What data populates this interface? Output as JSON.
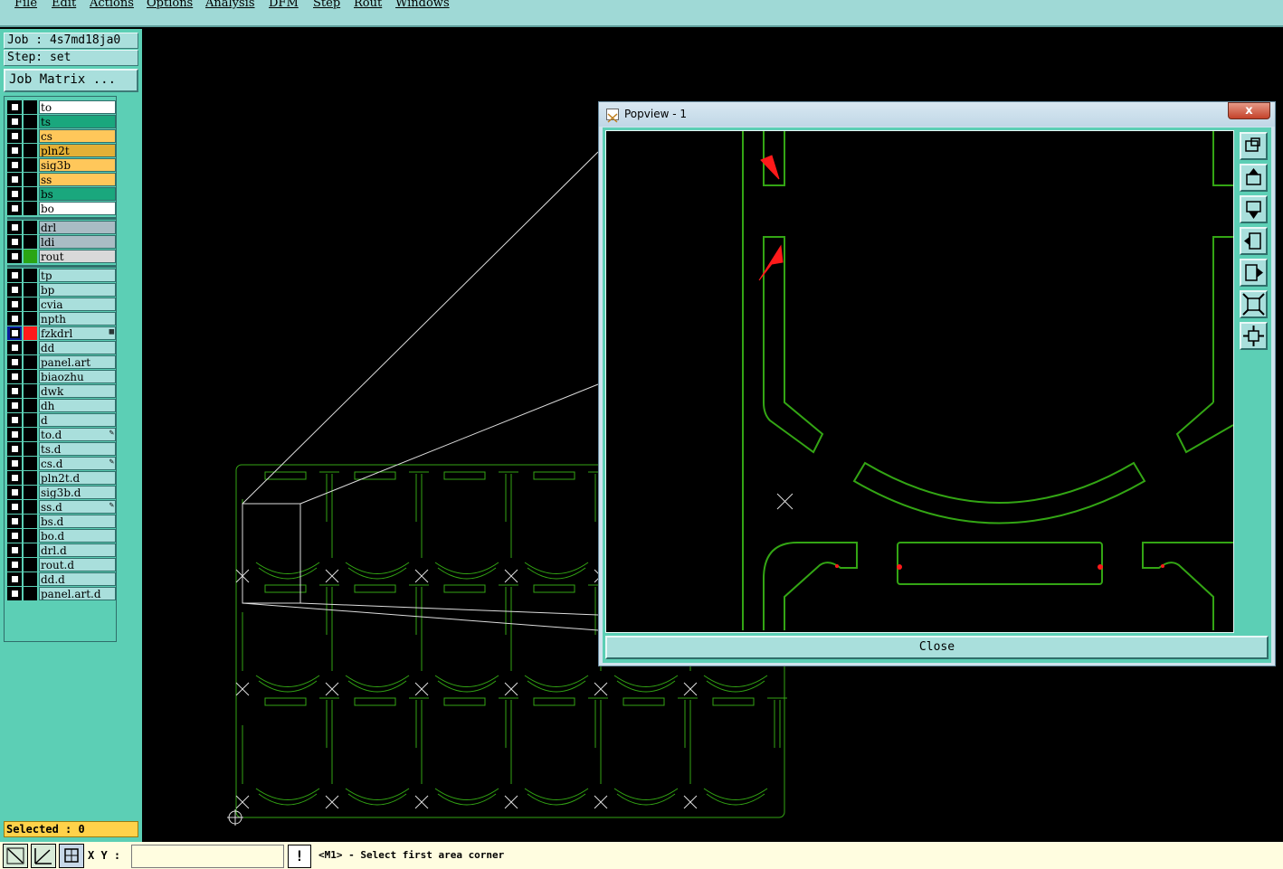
{
  "menu": [
    "File",
    "Edit",
    "Actions",
    "Options",
    "Analysis",
    "DFM",
    "Step",
    "Rout",
    "Windows"
  ],
  "job": {
    "label": "Job : 4s7md18ja0",
    "step": "Step: set",
    "matrix_button": "Job Matrix ..."
  },
  "layers": [
    {
      "name": "to",
      "color": "#ffffff"
    },
    {
      "name": "ts",
      "color": "#1aa77d"
    },
    {
      "name": "cs",
      "color": "#ffc75a"
    },
    {
      "name": "pln2t",
      "color": "#e3b036"
    },
    {
      "name": "sig3b",
      "color": "#ffc75a"
    },
    {
      "name": "ss",
      "color": "#ffc75a"
    },
    {
      "name": "bs",
      "color": "#1aa77d"
    },
    {
      "name": "bo",
      "color": "#ffffff"
    },
    {
      "name": "drl",
      "color": "#a9bcc4"
    },
    {
      "name": "ldi",
      "color": "#a9bcc4"
    },
    {
      "name": "rout",
      "color": "#d9d9d9"
    },
    {
      "name": "tp",
      "color": "#a9dfdc"
    },
    {
      "name": "bp",
      "color": "#a9dfdc"
    },
    {
      "name": "cvia",
      "color": "#a9dfdc"
    },
    {
      "name": "npth",
      "color": "#a9dfdc"
    },
    {
      "name": "fzkdrl",
      "color": "#a9dfdc"
    },
    {
      "name": "dd",
      "color": "#a9dfdc"
    },
    {
      "name": "panel.art",
      "color": "#a9dfdc"
    },
    {
      "name": "biaozhu",
      "color": "#a9dfdc"
    },
    {
      "name": "dwk",
      "color": "#a9dfdc"
    },
    {
      "name": "dh",
      "color": "#a9dfdc"
    },
    {
      "name": "d",
      "color": "#a9dfdc"
    },
    {
      "name": "to.d",
      "color": "#a9dfdc"
    },
    {
      "name": "ts.d",
      "color": "#a9dfdc"
    },
    {
      "name": "cs.d",
      "color": "#a9dfdc"
    },
    {
      "name": "pln2t.d",
      "color": "#a9dfdc"
    },
    {
      "name": "sig3b.d",
      "color": "#a9dfdc"
    },
    {
      "name": "ss.d",
      "color": "#a9dfdc"
    },
    {
      "name": "bs.d",
      "color": "#a9dfdc"
    },
    {
      "name": "bo.d",
      "color": "#a9dfdc"
    },
    {
      "name": "drl.d",
      "color": "#a9dfdc"
    },
    {
      "name": "rout.d",
      "color": "#a9dfdc"
    },
    {
      "name": "dd.d",
      "color": "#a9dfdc"
    },
    {
      "name": "panel.art.d",
      "color": "#a9dfdc"
    }
  ],
  "selected": "Selected : 0",
  "status": {
    "xy_label": "X Y :",
    "xy_value": "",
    "message": "<M1> - Select first area corner"
  },
  "popview": {
    "title": "Popview - 1",
    "close_x": "x",
    "close_label": "Close"
  },
  "colors": {
    "route": "#33a514",
    "marker": "#ff1a1a",
    "panel": "#5ccfb5",
    "field": "#a9dfdc"
  }
}
